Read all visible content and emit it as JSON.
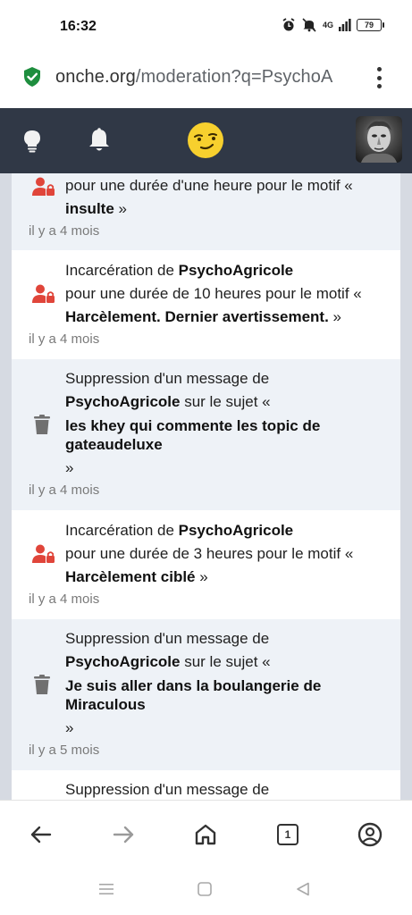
{
  "status": {
    "time": "16:32",
    "network": "4G",
    "battery": "79"
  },
  "browser": {
    "url_host": "onche.org",
    "url_path": "/moderation?q=PsychoA"
  },
  "entries": [
    {
      "kind": "incarceration",
      "line1_pre": "",
      "line1_user": "",
      "line1_post": "",
      "line2": "pour une durée d'une heure pour le motif «",
      "bold": "insulte",
      "close": " »",
      "time": "il y a 4 mois"
    },
    {
      "kind": "incarceration",
      "line1_pre": "Incarcération de ",
      "line1_user": "PsychoAgricole",
      "line2": "pour une durée de 10 heures pour le motif «",
      "bold": "Harcèlement. Dernier avertissement.",
      "close": " »",
      "time": "il y a 4 mois"
    },
    {
      "kind": "deletion",
      "line1_pre": "Suppression d'un message de",
      "line1_user": "PsychoAgricole",
      "line2": " sur le sujet «",
      "bold": "les khey qui commente les topic de gateaudeluxe",
      "close": "»",
      "time": "il y a 4 mois"
    },
    {
      "kind": "incarceration",
      "line1_pre": "Incarcération de ",
      "line1_user": "PsychoAgricole",
      "line2": "pour une durée de 3 heures pour le motif «",
      "bold": "Harcèlement ciblé",
      "close": " »",
      "time": "il y a 4 mois"
    },
    {
      "kind": "deletion",
      "line1_pre": "Suppression d'un message de",
      "line1_user": "PsychoAgricole",
      "line2": " sur le sujet «",
      "bold": "Je suis aller dans la boulangerie de Miraculous",
      "close": "»",
      "time": "il y a 5 mois"
    },
    {
      "kind": "deletion",
      "line1_pre": "Suppression d'un message de",
      "time": ""
    }
  ],
  "bottom_bar": {
    "tab_count": "1"
  },
  "icons": {
    "secure": "shield-check-icon",
    "menu": "more-vertical-icon",
    "idea": "lightbulb-icon",
    "notif": "bell-icon",
    "smiley": "smirk-emoji-icon",
    "jail": "user-lock-icon",
    "trash": "trash-icon"
  },
  "colors": {
    "navbar": "#303846",
    "jail_red": "#e0453a",
    "trash_gray": "#707070",
    "row_alt": "#eef2f7"
  }
}
